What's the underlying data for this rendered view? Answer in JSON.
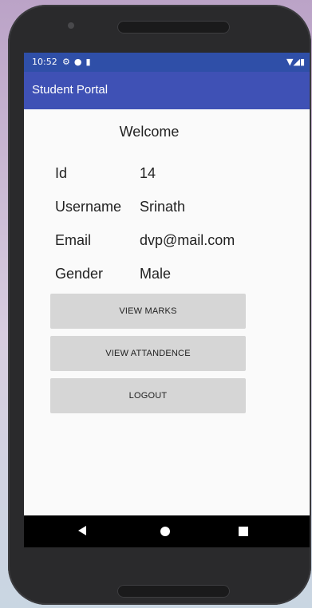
{
  "status_bar": {
    "time": "10:52",
    "left_icons": [
      "gear-icon",
      "shield-icon",
      "sd-card-icon"
    ],
    "right_icons": [
      "wifi-icon",
      "signal-icon",
      "battery-icon"
    ]
  },
  "app_bar": {
    "title": "Student Portal"
  },
  "profile": {
    "welcome": "Welcome",
    "rows": [
      {
        "label": "Id",
        "value": "14"
      },
      {
        "label": "Username",
        "value": "Srinath"
      },
      {
        "label": "Email",
        "value": "dvp@mail.com"
      },
      {
        "label": "Gender",
        "value": "Male"
      }
    ]
  },
  "actions": {
    "view_marks": "VIEW MARKS",
    "view_attendance": "VIEW ATTANDENCE",
    "logout": "LOGOUT"
  },
  "colors": {
    "status_bar": "#2f4fa8",
    "app_bar": "#3f51b5",
    "button_bg": "#d6d6d6",
    "nav_bar": "#000000"
  }
}
